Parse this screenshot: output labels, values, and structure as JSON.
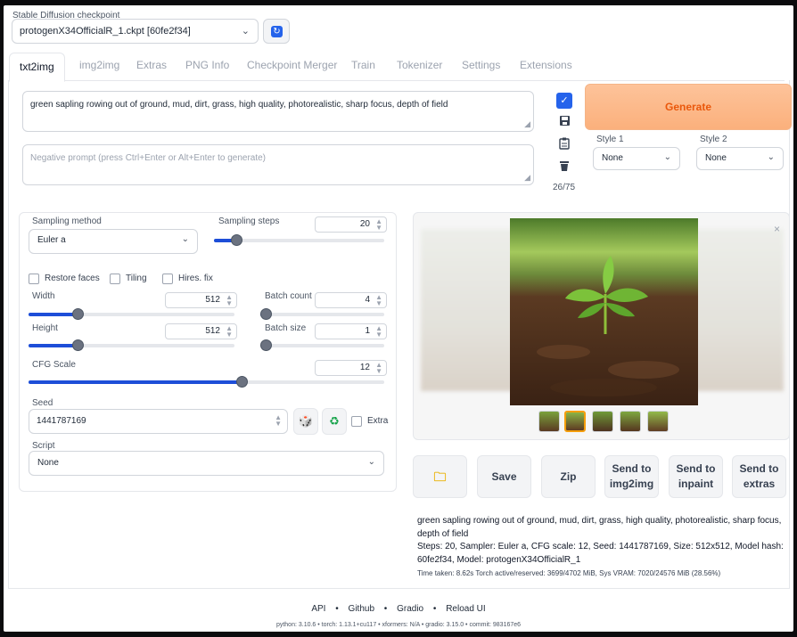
{
  "checkpoint": {
    "label": "Stable Diffusion checkpoint",
    "value": "protogenX34OfficialR_1.ckpt [60fe2f34]",
    "refresh_icon": "refresh-icon"
  },
  "tabs": [
    {
      "label": "txt2img",
      "active": true
    },
    {
      "label": "img2img"
    },
    {
      "label": "Extras"
    },
    {
      "label": "PNG Info"
    },
    {
      "label": "Checkpoint Merger"
    },
    {
      "label": "Train"
    },
    {
      "label": "Tokenizer"
    },
    {
      "label": "Settings"
    },
    {
      "label": "Extensions"
    }
  ],
  "prompt": {
    "value": "green sapling rowing out of ground, mud, dirt, grass, high quality, photorealistic, sharp focus, depth of field",
    "negative_placeholder": "Negative prompt (press Ctrl+Enter or Alt+Enter to generate)",
    "token_counter": "26/75",
    "tools": [
      "check-icon",
      "save-icon",
      "clipboard-icon",
      "trash-icon"
    ]
  },
  "generate_label": "Generate",
  "style1": {
    "label": "Style 1",
    "value": "None"
  },
  "style2": {
    "label": "Style 2",
    "value": "None"
  },
  "sampling": {
    "method_label": "Sampling method",
    "method_value": "Euler a",
    "steps_label": "Sampling steps",
    "steps_value": "20",
    "steps_fraction": 0.13
  },
  "checks": {
    "restore_faces": "Restore faces",
    "tiling": "Tiling",
    "hires_fix": "Hires. fix"
  },
  "width": {
    "label": "Width",
    "value": "512",
    "fraction": 0.24
  },
  "height": {
    "label": "Height",
    "value": "512",
    "fraction": 0.24
  },
  "batch_count": {
    "label": "Batch count",
    "value": "4",
    "fraction": 0.03
  },
  "batch_size": {
    "label": "Batch size",
    "value": "1",
    "fraction": 0.0
  },
  "cfg": {
    "label": "CFG Scale",
    "value": "12",
    "fraction": 0.6
  },
  "seed": {
    "label": "Seed",
    "value": "1441787169",
    "extra_label": "Extra"
  },
  "script": {
    "label": "Script",
    "value": "None"
  },
  "output_actions": [
    "Save",
    "Zip",
    "Send to img2img",
    "Send to inpaint",
    "Send to extras"
  ],
  "output_info": {
    "prompt": "green sapling rowing out of ground, mud, dirt, grass, high quality, photorealistic, sharp focus, depth of field",
    "params": "Steps: 20, Sampler: Euler a, CFG scale: 12, Seed: 1441787169, Size: 512x512, Model hash: 60fe2f34, Model: protogenX34OfficialR_1",
    "time": "Time taken: 8.62s  Torch active/reserved: 3699/4702 MiB, Sys VRAM: 7020/24576 MiB (28.56%)"
  },
  "footer": {
    "links": [
      "API",
      "Github",
      "Gradio",
      "Reload UI"
    ],
    "separator": "•",
    "versions": "python: 3.10.6  •  torch: 1.13.1+cu117  •  xformers: N/A  •  gradio: 3.15.0  •  commit: 983167e6"
  },
  "colors": {
    "accent": "#1d4ed8",
    "generate_text": "#ea580c",
    "generate_bg": "#fbb07c"
  }
}
